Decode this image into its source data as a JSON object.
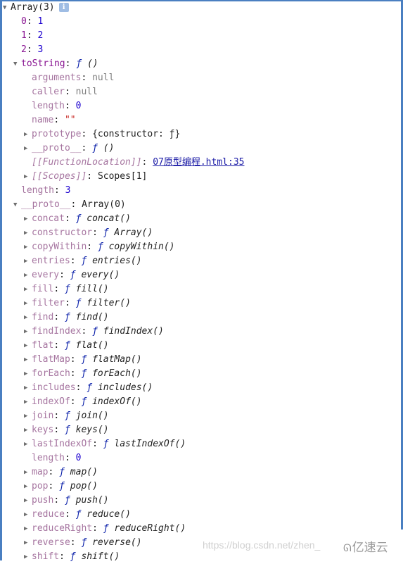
{
  "root": {
    "label": "Array(3)",
    "info_icon": "info-icon",
    "items": [
      {
        "key": "0",
        "value": "1"
      },
      {
        "key": "1",
        "value": "2"
      },
      {
        "key": "2",
        "value": "3"
      }
    ]
  },
  "toString": {
    "key": "toString",
    "value_prefix": "ƒ",
    "value": "()",
    "props": {
      "arguments": {
        "key": "arguments",
        "value": "null"
      },
      "caller": {
        "key": "caller",
        "value": "null"
      },
      "length": {
        "key": "length",
        "value": "0"
      },
      "name": {
        "key": "name",
        "value": "\"\""
      },
      "prototype": {
        "key": "prototype",
        "value": "{constructor: ƒ}"
      },
      "proto": {
        "key": "__proto__",
        "value_prefix": "ƒ",
        "value": "()"
      },
      "functionLocation": {
        "key": "[[FunctionLocation]]",
        "value": "07原型编程.html:35"
      },
      "scopes": {
        "key": "[[Scopes]]",
        "value": "Scopes[1]"
      }
    }
  },
  "length": {
    "key": "length",
    "value": "3"
  },
  "proto": {
    "key": "__proto__",
    "value": "Array(0)",
    "methods": [
      {
        "key": "concat",
        "fn": "concat()"
      },
      {
        "key": "constructor",
        "fn": "Array()"
      },
      {
        "key": "copyWithin",
        "fn": "copyWithin()"
      },
      {
        "key": "entries",
        "fn": "entries()"
      },
      {
        "key": "every",
        "fn": "every()"
      },
      {
        "key": "fill",
        "fn": "fill()"
      },
      {
        "key": "filter",
        "fn": "filter()"
      },
      {
        "key": "find",
        "fn": "find()"
      },
      {
        "key": "findIndex",
        "fn": "findIndex()"
      },
      {
        "key": "flat",
        "fn": "flat()"
      },
      {
        "key": "flatMap",
        "fn": "flatMap()"
      },
      {
        "key": "forEach",
        "fn": "forEach()"
      },
      {
        "key": "includes",
        "fn": "includes()"
      },
      {
        "key": "indexOf",
        "fn": "indexOf()"
      },
      {
        "key": "join",
        "fn": "join()"
      },
      {
        "key": "keys",
        "fn": "keys()"
      },
      {
        "key": "lastIndexOf",
        "fn": "lastIndexOf()"
      }
    ],
    "length": {
      "key": "length",
      "value": "0"
    },
    "methods2": [
      {
        "key": "map",
        "fn": "map()"
      },
      {
        "key": "pop",
        "fn": "pop()"
      },
      {
        "key": "push",
        "fn": "push()"
      },
      {
        "key": "reduce",
        "fn": "reduce()"
      },
      {
        "key": "reduceRight",
        "fn": "reduceRight()"
      },
      {
        "key": "reverse",
        "fn": "reverse()"
      },
      {
        "key": "shift",
        "fn": "shift()"
      }
    ]
  },
  "f_glyph": "ƒ",
  "colon": ":",
  "expand_glyph": "▶",
  "collapse_glyph": "▼",
  "watermark": "https://blog.csdn.net/zhen_",
  "brand": {
    "logo": "ᘏ",
    "name": "亿速云"
  }
}
